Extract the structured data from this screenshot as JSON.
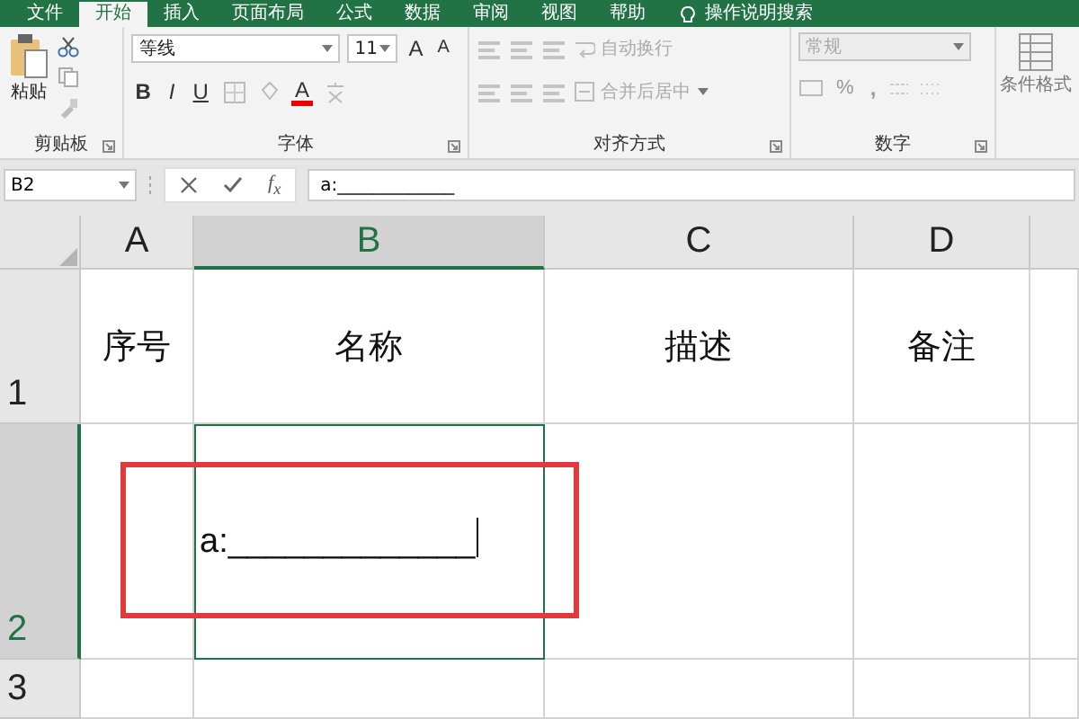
{
  "tabs": [
    {
      "label": "文件",
      "selected": false
    },
    {
      "label": "开始",
      "selected": true
    },
    {
      "label": "插入",
      "selected": false
    },
    {
      "label": "页面布局",
      "selected": false
    },
    {
      "label": "公式",
      "selected": false
    },
    {
      "label": "数据",
      "selected": false
    },
    {
      "label": "审阅",
      "selected": false
    },
    {
      "label": "视图",
      "selected": false
    },
    {
      "label": "帮助",
      "selected": false
    }
  ],
  "tell_me": {
    "label": "操作说明搜索"
  },
  "ribbon": {
    "groups": [
      {
        "kind": "clipboard",
        "label": "剪贴板",
        "paste_label": "粘贴"
      },
      {
        "kind": "font",
        "label": "字体",
        "font_name": "等线",
        "font_size": "11",
        "grow_label": "A",
        "shrink_label": "A",
        "bold_label": "B",
        "italic_label": "I",
        "underline_label": "U",
        "font_color_label": "A"
      },
      {
        "kind": "alignment",
        "label": "对齐方式",
        "wrap_text": {
          "label": "自动换行",
          "disabled": true
        },
        "merge_center": {
          "label": "合并后居中",
          "disabled": true
        }
      },
      {
        "kind": "number",
        "label": "数字",
        "format": {
          "value": "常规",
          "disabled": true
        },
        "percent": "%",
        "comma": ","
      },
      {
        "kind": "styles",
        "conditional_format": {
          "label": "条件格式",
          "disabled": true
        }
      }
    ]
  },
  "formula_bar": {
    "name_box": "B2",
    "insert_function": "f$_{x}$",
    "formula": "a:_____________"
  },
  "sheet": {
    "columns": [
      {
        "label": "A",
        "selected": false
      },
      {
        "label": "B",
        "selected": true
      },
      {
        "label": "C",
        "selected": false
      },
      {
        "label": "D",
        "selected": false
      }
    ],
    "rows": [
      {
        "label": "1",
        "selected": false,
        "cells": [
          {
            "text": "序号",
            "selected": false
          },
          {
            "text": "名称",
            "selected": false
          },
          {
            "text": "描述",
            "selected": false
          },
          {
            "text": "备注",
            "selected": false
          }
        ]
      },
      {
        "label": "2",
        "selected": true,
        "cells": [
          {
            "selected": false
          },
          {
            "text": "a:_____________",
            "selected": true,
            "editing": true
          },
          {
            "selected": false
          },
          {
            "selected": false
          }
        ]
      },
      {
        "label": "3",
        "selected": false,
        "cells": [
          {
            "selected": false
          },
          {
            "selected": false
          },
          {
            "selected": false
          },
          {
            "selected": false
          }
        ]
      }
    ]
  }
}
